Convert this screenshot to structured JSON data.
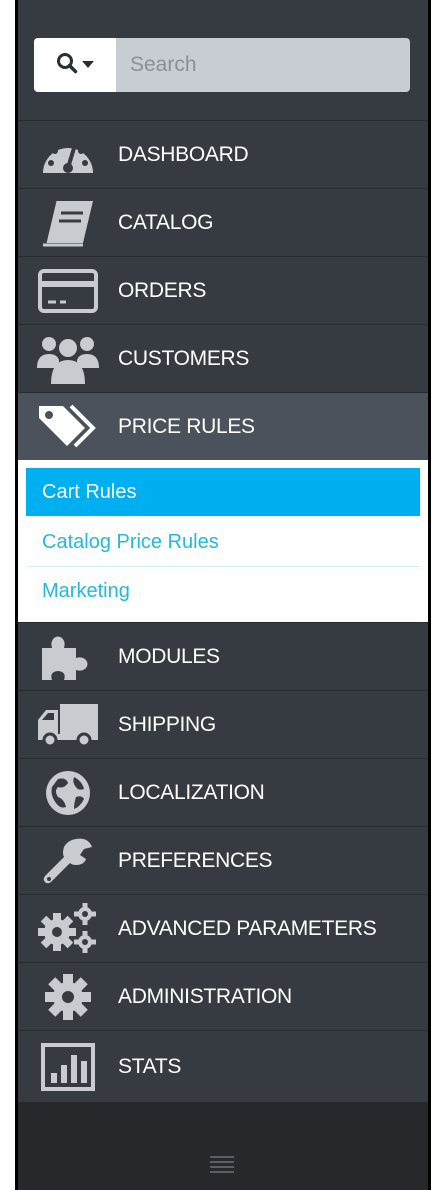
{
  "search": {
    "placeholder": "Search"
  },
  "menu": [
    {
      "id": "dashboard",
      "label": "DASHBOARD",
      "icon": "dashboard-icon"
    },
    {
      "id": "catalog",
      "label": "CATALOG",
      "icon": "book-icon"
    },
    {
      "id": "orders",
      "label": "ORDERS",
      "icon": "credit-card-icon"
    },
    {
      "id": "customers",
      "label": "CUSTOMERS",
      "icon": "users-icon"
    },
    {
      "id": "price-rules",
      "label": "PRICE RULES",
      "icon": "tags-icon",
      "active": true
    },
    {
      "id": "modules",
      "label": "MODULES",
      "icon": "puzzle-icon"
    },
    {
      "id": "shipping",
      "label": "SHIPPING",
      "icon": "truck-icon"
    },
    {
      "id": "localization",
      "label": "LOCALIZATION",
      "icon": "globe-icon"
    },
    {
      "id": "preferences",
      "label": "PREFERENCES",
      "icon": "wrench-icon"
    },
    {
      "id": "advanced-parameters",
      "label": "ADVANCED PARAMETERS",
      "icon": "cogs-icon"
    },
    {
      "id": "administration",
      "label": "ADMINISTRATION",
      "icon": "cog-icon"
    },
    {
      "id": "stats",
      "label": "STATS",
      "icon": "bar-chart-icon"
    }
  ],
  "submenu": [
    {
      "label": "Cart Rules",
      "active": true
    },
    {
      "label": "Catalog Price Rules"
    },
    {
      "label": "Marketing"
    }
  ],
  "colors": {
    "sidebar_bg": "#363a41",
    "active_item_bg": "#4b525c",
    "icon_color": "#c8ccd0",
    "submenu_active_bg": "#00aff0",
    "submenu_link": "#24b9d7"
  }
}
